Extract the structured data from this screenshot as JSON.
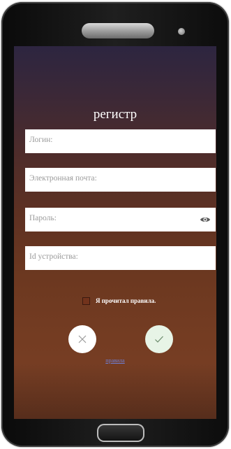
{
  "screen": {
    "title": "регистр",
    "fields": {
      "login_placeholder": "Логин:",
      "email_placeholder": "Электронная почта:",
      "password_placeholder": "Пароль:",
      "device_id_placeholder": "Id устройства:"
    },
    "agree_label": "Я прочитал правила.",
    "rules_link": "правила",
    "icons": {
      "cancel": "close-icon",
      "confirm": "check-icon",
      "password_visibility": "eye-icon"
    }
  },
  "colors": {
    "background_top": "#2d2540",
    "background_bottom": "#7a4026",
    "confirm_button": "#e7f4e6",
    "link": "#6e7fd6"
  }
}
